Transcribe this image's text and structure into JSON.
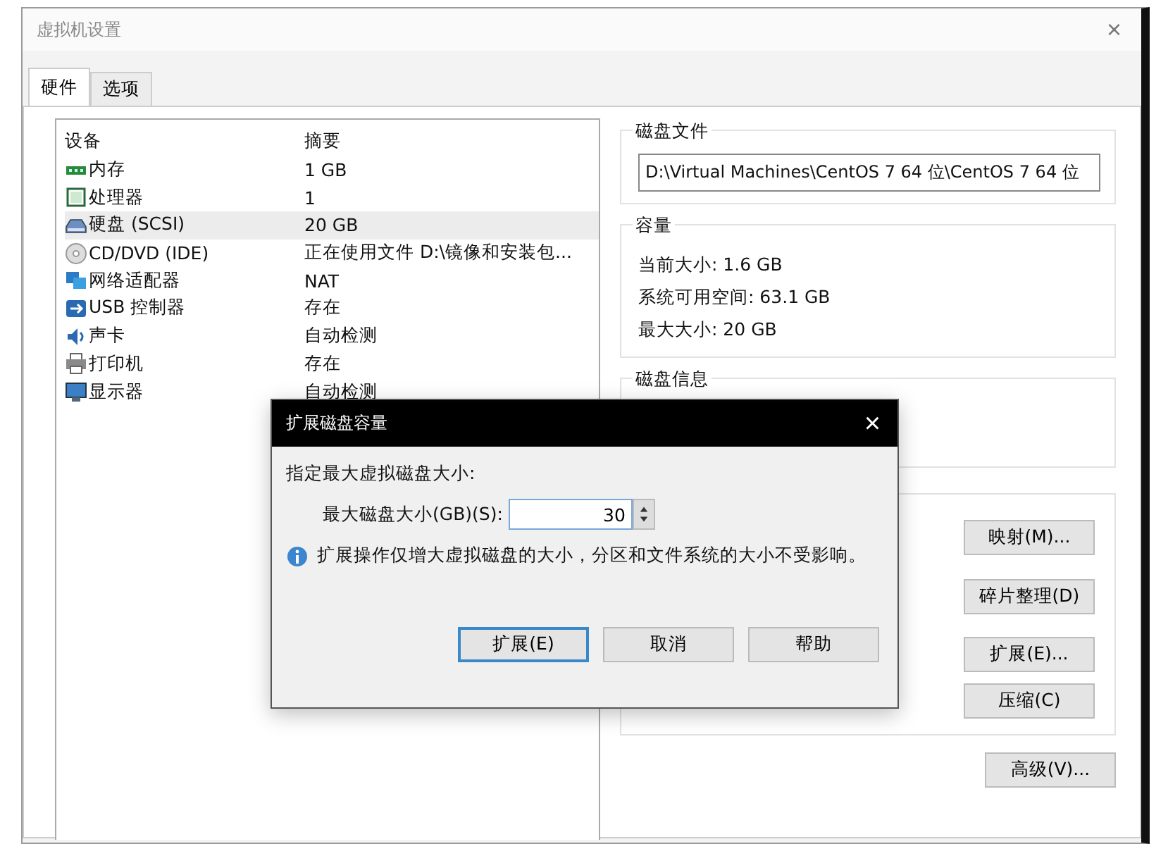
{
  "window": {
    "title": "虚拟机设置",
    "close": "×"
  },
  "tabs": [
    {
      "label": "硬件",
      "selected": true
    },
    {
      "label": "选项",
      "selected": false
    }
  ],
  "devices": {
    "columns": [
      "设备",
      "摘要"
    ],
    "rows": [
      {
        "name": "内存",
        "summary": "1 GB",
        "selected": false
      },
      {
        "name": "处理器",
        "summary": "1",
        "selected": false
      },
      {
        "name": "硬盘 (SCSI)",
        "summary": "20 GB",
        "selected": true
      },
      {
        "name": "CD/DVD (IDE)",
        "summary": "正在使用文件 D:\\镜像和安装包...",
        "selected": false
      },
      {
        "name": "网络适配器",
        "summary": "NAT",
        "selected": false
      },
      {
        "name": "USB 控制器",
        "summary": "存在",
        "selected": false
      },
      {
        "name": "声卡",
        "summary": "自动检测",
        "selected": false
      },
      {
        "name": "打印机",
        "summary": "存在",
        "selected": false
      },
      {
        "name": "显示器",
        "summary": "自动检测",
        "selected": false
      }
    ]
  },
  "disk_file": {
    "title": "磁盘文件",
    "value": "D:\\Virtual Machines\\CentOS 7 64 位\\CentOS 7 64 位"
  },
  "capacity": {
    "title": "容量",
    "lines": [
      "当前大小: 1.6 GB",
      "系统可用空间: 63.1 GB",
      "最大大小: 20 GB"
    ]
  },
  "disk_info": {
    "title": "磁盘信息"
  },
  "utilities": {
    "buttons": [
      "映射(M)...",
      "碎片整理(D)",
      "扩展(E)...",
      "压缩(C)"
    ]
  },
  "advanced_button": "高级(V)...",
  "dialog": {
    "title": "扩展磁盘容量",
    "close": "×",
    "prompt": "指定最大虚拟磁盘大小:",
    "size_label": "最大磁盘大小(GB)(S):",
    "size_value": "30",
    "note": "扩展操作仅增大虚拟磁盘的大小，分区和文件系统的大小不受影响。",
    "buttons": [
      {
        "label": "扩展(E)",
        "default": true
      },
      {
        "label": "取消",
        "default": false
      },
      {
        "label": "帮助",
        "default": false
      }
    ]
  }
}
